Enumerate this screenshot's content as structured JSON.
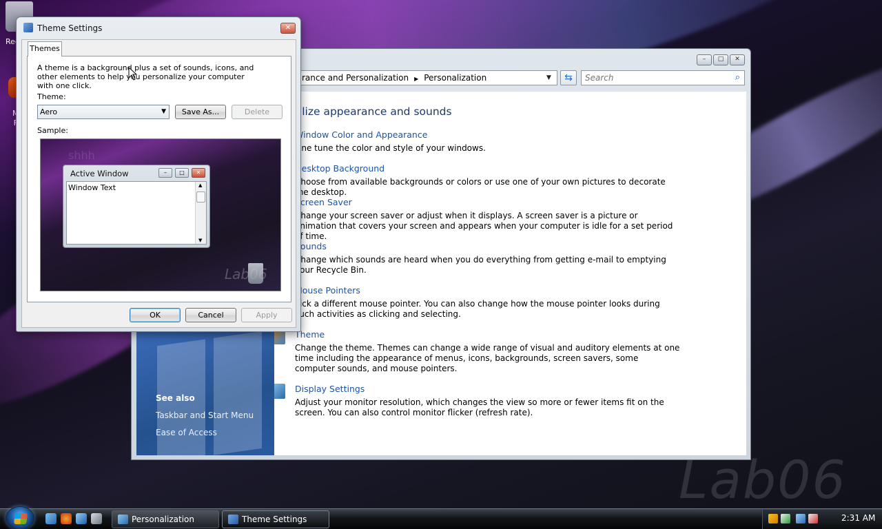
{
  "desktop": {
    "recycle_label": "Rec",
    "firefox_label_1": "M",
    "firefox_label_2": "F",
    "watermark": "Lab06"
  },
  "personalization_window": {
    "address": {
      "crumb_1": "rance and Personalization",
      "crumb_2": "Personalization"
    },
    "search_placeholder": "Search",
    "title": "rsonalize appearance and sounds",
    "tasks": [
      {
        "link": "Window Color and Appearance",
        "desc": "Fine tune the color and style of your windows.",
        "icon": "palette-icon"
      },
      {
        "link": "Desktop Background",
        "desc": "Choose from available backgrounds or colors or use one of your own pictures to decorate the desktop.",
        "icon": "desktop-icon"
      },
      {
        "link": "Screen Saver",
        "desc": "Change your screen saver or adjust when it displays. A screen saver is a picture or animation that covers your screen and appears when your computer is idle for a set period of time.",
        "icon": "screensaver-icon"
      },
      {
        "link": "Sounds",
        "desc": "Change which sounds are heard when you do everything from getting e-mail to emptying your Recycle Bin.",
        "icon": "speaker-icon"
      },
      {
        "link": "Mouse Pointers",
        "desc": "Pick a different mouse pointer. You can also change how the mouse pointer looks during such activities as clicking and selecting.",
        "icon": "mouse-icon"
      },
      {
        "link": "Theme",
        "desc": "Change the theme. Themes can change a wide range of visual and auditory elements at one time including the appearance of menus, icons, backgrounds, screen savers, some computer sounds, and mouse pointers.",
        "icon": "theme-icon"
      },
      {
        "link": "Display Settings",
        "desc": "Adjust your monitor resolution, which changes the view so more or fewer items fit on the screen. You can also control monitor flicker (refresh rate).",
        "icon": "monitor-icon"
      }
    ],
    "see_also": {
      "heading": "See also",
      "links": [
        "Taskbar and Start Menu",
        "Ease of Access"
      ]
    }
  },
  "theme_dialog": {
    "title": "Theme Settings",
    "tab": "Themes",
    "intro": "A theme is a background plus a set of sounds, icons, and other elements to help you personalize your computer with one click.",
    "theme_label": "Theme:",
    "theme_value": "Aero",
    "save_as": "Save As...",
    "delete": "Delete",
    "sample_label": "Sample:",
    "sample": {
      "window_title": "Active Window",
      "window_text": "Window Text",
      "bg_word": "shhh",
      "watermark": "Lab06"
    },
    "ok": "OK",
    "cancel": "Cancel",
    "apply": "Apply"
  },
  "taskbar": {
    "buttons": [
      "Personalization",
      "Theme Settings"
    ],
    "clock": "2:31 AM"
  }
}
